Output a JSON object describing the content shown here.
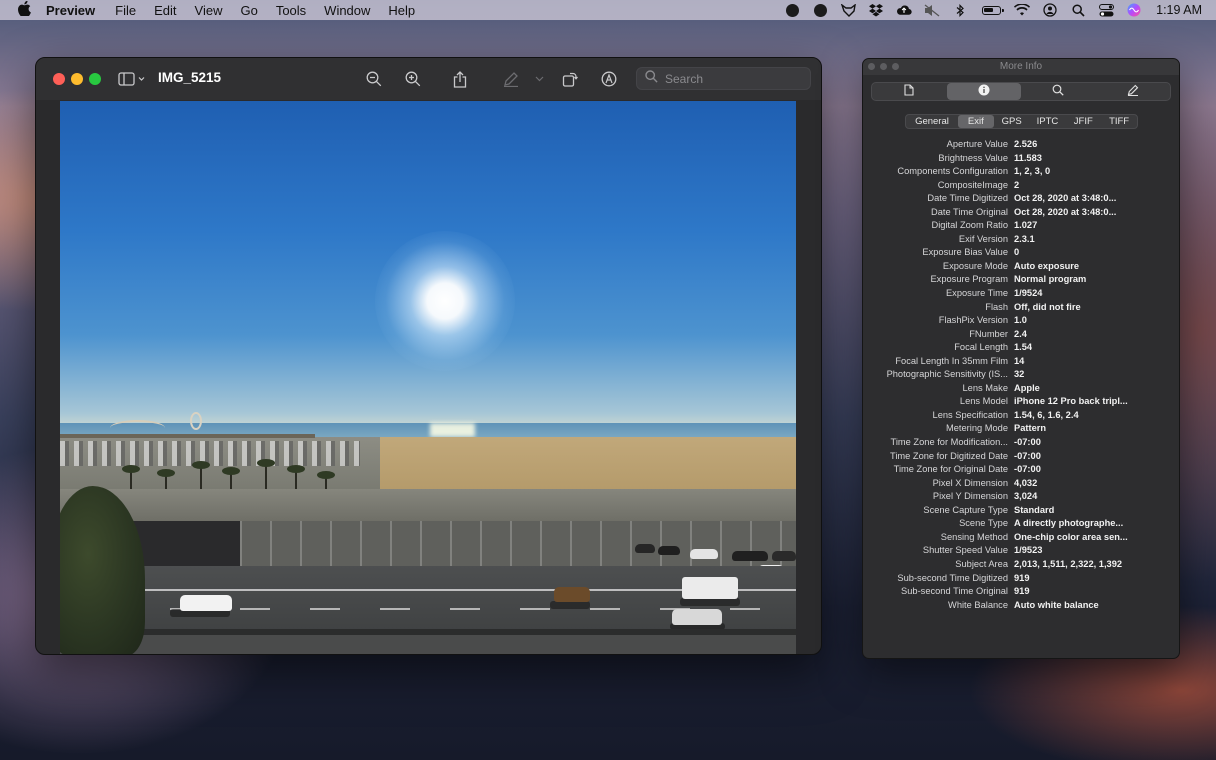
{
  "menubar": {
    "app": "Preview",
    "items": [
      "File",
      "Edit",
      "View",
      "Go",
      "Tools",
      "Window",
      "Help"
    ],
    "clock": "1:19 AM"
  },
  "window": {
    "title": "IMG_5215",
    "search_placeholder": "Search"
  },
  "info_panel": {
    "title": "More Info",
    "tabs": [
      "General",
      "Exif",
      "GPS",
      "IPTC",
      "JFIF",
      "TIFF"
    ],
    "active_tab": "Exif",
    "rows": [
      {
        "key": "Aperture Value",
        "value": "2.526"
      },
      {
        "key": "Brightness Value",
        "value": "11.583"
      },
      {
        "key": "Components Configuration",
        "value": "1, 2, 3, 0"
      },
      {
        "key": "CompositeImage",
        "value": "2"
      },
      {
        "key": "Date Time Digitized",
        "value": "Oct 28, 2020 at 3:48:0..."
      },
      {
        "key": "Date Time Original",
        "value": "Oct 28, 2020 at 3:48:0..."
      },
      {
        "key": "Digital Zoom Ratio",
        "value": "1.027"
      },
      {
        "key": "Exif Version",
        "value": "2.3.1"
      },
      {
        "key": "Exposure Bias Value",
        "value": "0"
      },
      {
        "key": "Exposure Mode",
        "value": "Auto exposure"
      },
      {
        "key": "Exposure Program",
        "value": "Normal program"
      },
      {
        "key": "Exposure Time",
        "value": "1/9524"
      },
      {
        "key": "Flash",
        "value": "Off, did not fire"
      },
      {
        "key": "FlashPix Version",
        "value": "1.0"
      },
      {
        "key": "FNumber",
        "value": "2.4"
      },
      {
        "key": "Focal Length",
        "value": "1.54"
      },
      {
        "key": "Focal Length In 35mm Film",
        "value": "14"
      },
      {
        "key": "Photographic Sensitivity (IS...",
        "value": "32"
      },
      {
        "key": "Lens Make",
        "value": "Apple"
      },
      {
        "key": "Lens Model",
        "value": "iPhone 12 Pro back tripl..."
      },
      {
        "key": "Lens Specification",
        "value": "1.54, 6, 1.6, 2.4"
      },
      {
        "key": "Metering Mode",
        "value": "Pattern"
      },
      {
        "key": "Time Zone for Modification...",
        "value": "-07:00"
      },
      {
        "key": "Time Zone for Digitized Date",
        "value": "-07:00"
      },
      {
        "key": "Time Zone for Original Date",
        "value": "-07:00"
      },
      {
        "key": "Pixel X Dimension",
        "value": "4,032"
      },
      {
        "key": "Pixel Y Dimension",
        "value": "3,024"
      },
      {
        "key": "Scene Capture Type",
        "value": "Standard"
      },
      {
        "key": "Scene Type",
        "value": "A directly photographe..."
      },
      {
        "key": "Sensing Method",
        "value": "One-chip color area sen..."
      },
      {
        "key": "Shutter Speed Value",
        "value": "1/9523"
      },
      {
        "key": "Subject Area",
        "value": "2,013, 1,511, 2,322, 1,392"
      },
      {
        "key": "Sub-second Time Digitized",
        "value": "919"
      },
      {
        "key": "Sub-second Time Original",
        "value": "919"
      },
      {
        "key": "White Balance",
        "value": "Auto white balance"
      }
    ]
  },
  "colors": {
    "close": "#fe5f57",
    "minimize": "#febc2e",
    "maximize": "#28c840",
    "window_bg": "#2a2a2c",
    "panel_bg": "#2d2d2f"
  },
  "icons": {
    "menubar": [
      "apple-logo-icon",
      "status-avatar-icon",
      "status-avatar-icon",
      "fox-icon",
      "dropbox-icon",
      "icloud-icon",
      "mute-icon",
      "bluetooth-icon",
      "battery-icon",
      "wifi-icon",
      "user-icon",
      "search-icon",
      "control-center-icon",
      "siri-icon"
    ],
    "toolbar": [
      "sidebar-icon",
      "zoom-out-icon",
      "zoom-in-icon",
      "share-icon",
      "markup-icon",
      "rotate-icon",
      "annotate-icon",
      "search-icon"
    ],
    "inspector": [
      "file-icon",
      "info-icon",
      "magnifier-icon",
      "pencil-icon"
    ]
  }
}
